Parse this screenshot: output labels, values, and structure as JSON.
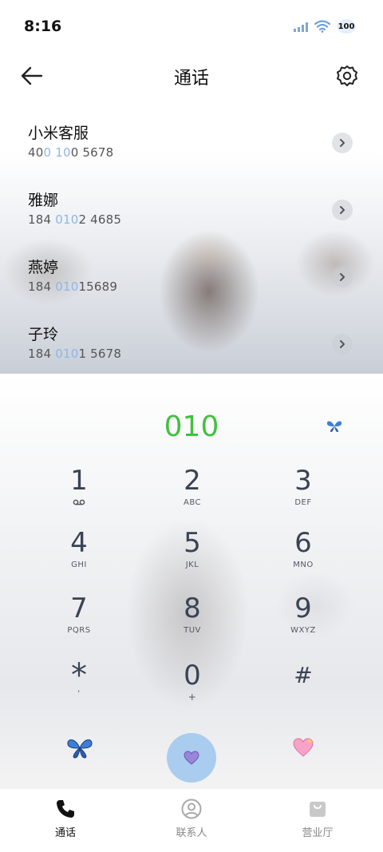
{
  "status_bar": {
    "time": "8:16",
    "battery": "100"
  },
  "header": {
    "title": "通话"
  },
  "contacts": [
    {
      "name": "小米客服",
      "num_pre": "40",
      "num_hl": "0 10",
      "num_post": "0 5678"
    },
    {
      "name": "雅娜",
      "num_pre": "184 ",
      "num_hl": "010",
      "num_post": "2 4685"
    },
    {
      "name": "燕婷",
      "num_pre": "184 ",
      "num_hl": "010",
      "num_post": "15689"
    },
    {
      "name": "子玲",
      "num_pre": "184 ",
      "num_hl": "010",
      "num_post": "1 5678"
    }
  ],
  "dial": {
    "number": "010"
  },
  "keypad": [
    {
      "digit": "1",
      "letters": ""
    },
    {
      "digit": "2",
      "letters": "ABC"
    },
    {
      "digit": "3",
      "letters": "DEF"
    },
    {
      "digit": "4",
      "letters": "GHI"
    },
    {
      "digit": "5",
      "letters": "JKL"
    },
    {
      "digit": "6",
      "letters": "MNO"
    },
    {
      "digit": "7",
      "letters": "PQRS"
    },
    {
      "digit": "8",
      "letters": "TUV"
    },
    {
      "digit": "9",
      "letters": "WXYZ"
    },
    {
      "digit": "*",
      "letters": ","
    },
    {
      "digit": "0",
      "letters": "+"
    },
    {
      "digit": "#",
      "letters": ""
    }
  ],
  "nav": [
    {
      "label": "通话",
      "icon": "phone-icon",
      "active": true
    },
    {
      "label": "联系人",
      "icon": "person-icon",
      "active": false
    },
    {
      "label": "营业厅",
      "icon": "shopping-bag-icon",
      "active": false
    }
  ],
  "colors": {
    "dial_number": "#43c13f",
    "highlight": "#8fb6e6",
    "call_button": "#a9ccef",
    "key_text": "#3a4354"
  }
}
